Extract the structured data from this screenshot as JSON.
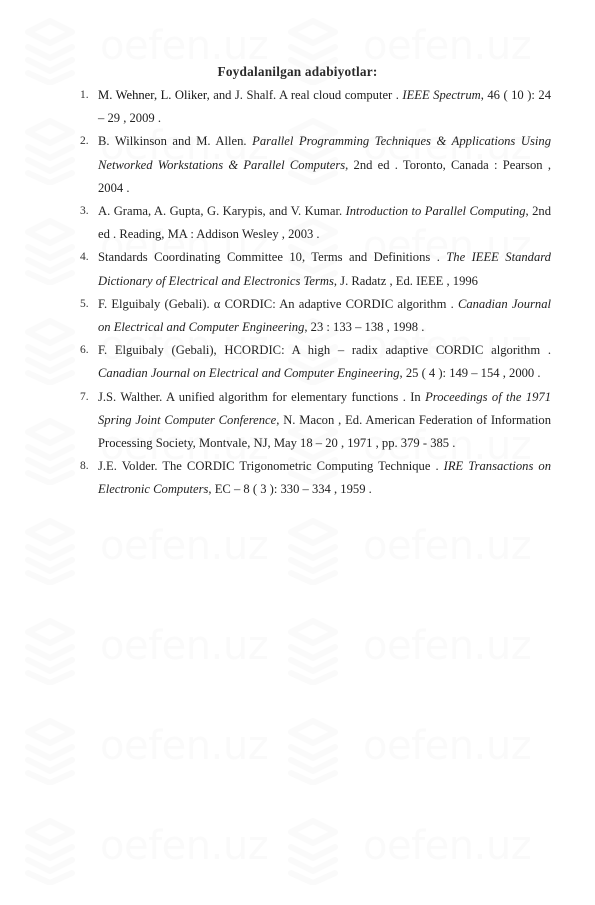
{
  "watermark": {
    "text": "oefen.uz",
    "icon": "stacked-layers-icon"
  },
  "document": {
    "title": "Foydalanilgan adabiyotlar:",
    "references": [
      {
        "number": "1.",
        "parts": [
          {
            "text": "M. Wehner, L. Oliker",
            "style": "author"
          },
          {
            "text": ", and J. Shalf. A real cloud computer . ",
            "style": "normal"
          },
          {
            "text": "IEEE Spectrum",
            "style": "italic"
          },
          {
            "text": ", 46 ( 10 ): 24 – 29 , 2009 .",
            "style": "normal"
          }
        ]
      },
      {
        "number": "2.",
        "parts": [
          {
            "text": "B. Wilkinson and M. Allen. ",
            "style": "normal"
          },
          {
            "text": "Parallel Programming Techniques & Applications Using Networked Workstations & Parallel Computers",
            "style": "italic"
          },
          {
            "text": ", 2nd ed . Toronto, Canada : Pearson , 2004 .",
            "style": "normal"
          }
        ]
      },
      {
        "number": "3.",
        "parts": [
          {
            "text": "A. Grama, A. Gupta, G. Karypis, and V. Kumar. ",
            "style": "normal"
          },
          {
            "text": "Introduction to Parallel Computing",
            "style": "italic"
          },
          {
            "text": ", 2nd ed . Reading, MA : Addison Wesley , 2003 .",
            "style": "normal"
          }
        ]
      },
      {
        "number": "4.",
        "parts": [
          {
            "text": "Standards Coordinating Committee 10, Terms and Definitions . ",
            "style": "normal"
          },
          {
            "text": "The IEEE Standard Dictionary of Electrical and Electronics Terms",
            "style": "italic"
          },
          {
            "text": ", J. Radatz , Ed. IEEE , 1996",
            "style": "normal"
          }
        ]
      },
      {
        "number": "5.",
        "parts": [
          {
            "text": "F. Elguibaly (Gebali). α CORDIC: An adaptive CORDIC algorithm . ",
            "style": "normal"
          },
          {
            "text": "Canadian Journal on Electrical and Computer Engineering",
            "style": "italic"
          },
          {
            "text": ", 23 : 133 – 138 , 1998 .",
            "style": "normal"
          }
        ]
      },
      {
        "number": "6.",
        "parts": [
          {
            "text": "F. Elguibaly (Gebali), HCORDIC: A high – radix adaptive CORDIC algorithm . ",
            "style": "normal"
          },
          {
            "text": "Canadian Journal on Electrical and Computer Engineering",
            "style": "italic"
          },
          {
            "text": ", 25 ( 4 ): 149 – 154 , 2000 .",
            "style": "normal"
          }
        ]
      },
      {
        "number": "7.",
        "parts": [
          {
            "text": "J.S. Walther. A unified algorithm for elementary functions . In ",
            "style": "normal"
          },
          {
            "text": "Proceedings of the 1971 Spring Joint Computer Conference",
            "style": "italic"
          },
          {
            "text": ", N. Macon , Ed. American Federation of Information Processing Society, Montvale, NJ, May 18 – 20 , 1971 , pp. 379 - 385 .",
            "style": "normal"
          }
        ]
      },
      {
        "number": "8.",
        "parts": [
          {
            "text": "J.E. Volder. The CORDIC Trigonometric Computing Technique . ",
            "style": "normal"
          },
          {
            "text": "IRE Transactions on Electronic Computers",
            "style": "italic"
          },
          {
            "text": ", EC – 8 ( 3 ): 330 – 334 , 1959 .",
            "style": "normal"
          }
        ]
      }
    ]
  }
}
